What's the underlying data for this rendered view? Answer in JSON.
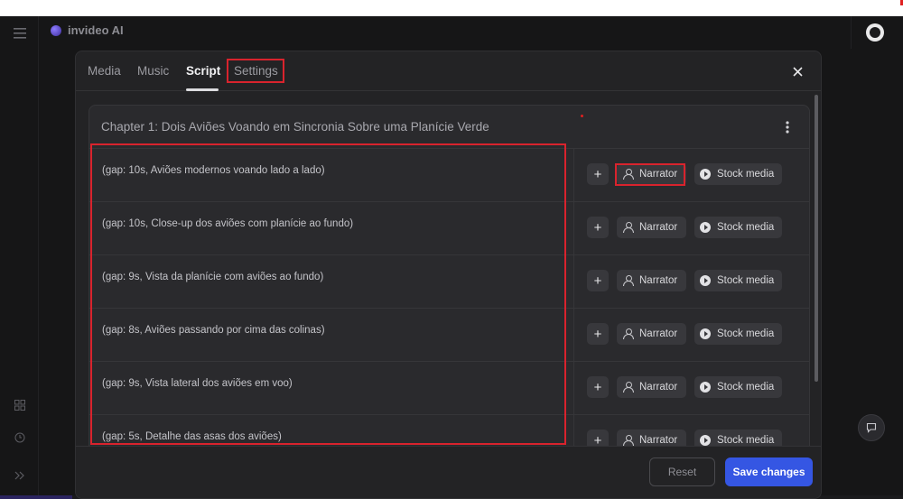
{
  "app": {
    "brand": "invideo AI",
    "left_rail_icons": [
      "menu-icon",
      "grid-icon",
      "clock-icon",
      "expand-icon"
    ],
    "avatar_icon": "avatar-icon",
    "chat_icon": "chat-icon"
  },
  "modal": {
    "tabs": [
      {
        "label": "Media",
        "active": false
      },
      {
        "label": "Music",
        "active": false
      },
      {
        "label": "Script",
        "active": true
      },
      {
        "label": "Settings",
        "active": false
      }
    ],
    "close_icon": "close-icon",
    "chapter": {
      "title": "Chapter 1: Dois Aviões Voando em Sincronia Sobre uma Planície Verde",
      "more_icon": "more-vertical-icon",
      "rows": [
        {
          "text": "(gap: 10s, Aviões modernos voando lado a lado)",
          "add": "+",
          "narrator": "Narrator",
          "stock": "Stock media"
        },
        {
          "text": "(gap: 10s, Close-up dos aviões com planície ao fundo)",
          "add": "+",
          "narrator": "Narrator",
          "stock": "Stock media"
        },
        {
          "text": "(gap: 9s, Vista da planície com aviões ao fundo)",
          "add": "+",
          "narrator": "Narrator",
          "stock": "Stock media"
        },
        {
          "text": "(gap: 8s, Aviões passando por cima das colinas)",
          "add": "+",
          "narrator": "Narrator",
          "stock": "Stock media"
        },
        {
          "text": "(gap: 9s, Vista lateral dos aviões em voo)",
          "add": "+",
          "narrator": "Narrator",
          "stock": "Stock media"
        },
        {
          "text": "(gap: 5s, Detalhe das asas dos aviões)",
          "add": "+",
          "narrator": "Narrator",
          "stock": "Stock media"
        }
      ]
    },
    "footer": {
      "reset_label": "Reset",
      "save_label": "Save changes"
    }
  },
  "colors": {
    "accent": "#3556e3",
    "highlight": "#d9232d",
    "background": "#161617",
    "panel": "#232325"
  }
}
